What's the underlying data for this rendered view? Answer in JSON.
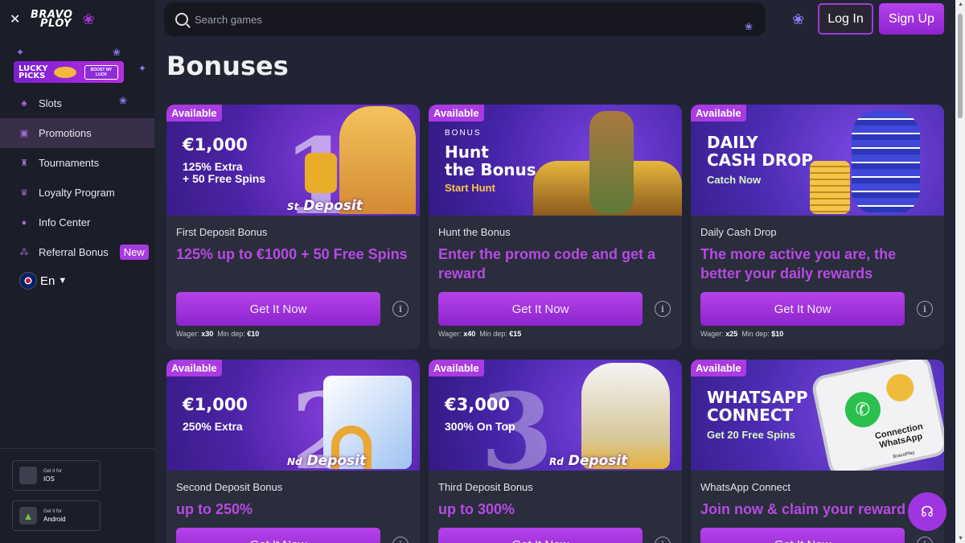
{
  "brand": {
    "name_line1": "BRAVO",
    "name_line2": "PLOY"
  },
  "promo_banner": {
    "title": "LUCKY PICKS",
    "button": "BOOST MY LUCK"
  },
  "header": {
    "search_placeholder": "Search games",
    "login_label": "Log In",
    "signup_label": "Sign Up"
  },
  "sidebar": {
    "items": [
      {
        "label": "Slots",
        "icon": "slots-icon"
      },
      {
        "label": "Promotions",
        "icon": "gift-icon",
        "active": true
      },
      {
        "label": "Tournaments",
        "icon": "trophy-icon"
      },
      {
        "label": "Loyalty Program",
        "icon": "crown-icon"
      },
      {
        "label": "Info Center",
        "icon": "info-icon"
      },
      {
        "label": "Referral Bonus",
        "icon": "users-icon",
        "badge": "New"
      }
    ],
    "language": "En",
    "stores": [
      {
        "small": "Get it for",
        "name": "IOS",
        "icon": "apple-icon"
      },
      {
        "small": "Get it for",
        "name": "Android",
        "icon": "android-icon"
      }
    ]
  },
  "page_title": "Bonuses",
  "cards": [
    {
      "badge": "Available",
      "banner": {
        "amount": "€1,000",
        "line1": "125% Extra",
        "line2": "+ 50 Free Spins",
        "big": "1",
        "ordinal": "St",
        "deposit": "Deposit"
      },
      "label": "First Deposit Bonus",
      "headline": "125% up to €1000 + 50 Free Spins",
      "button": "Get It Now",
      "wager_label": "Wager:",
      "wager": "x30",
      "min_label": "Min dep:",
      "min": "€10"
    },
    {
      "badge": "Available",
      "banner": {
        "small": "BONUS",
        "title1": "Hunt",
        "title2": "the Bonus",
        "cta": "Start Hunt"
      },
      "label": "Hunt the Bonus",
      "headline": "Enter the promo code and get a reward",
      "button": "Get It Now",
      "wager_label": "Wager:",
      "wager": "x40",
      "min_label": "Min dep:",
      "min": "€15"
    },
    {
      "badge": "Available",
      "banner": {
        "title1": "DAILY",
        "title2": "CASH DROP",
        "cta": "Catch Now"
      },
      "label": "Daily Cash Drop",
      "headline": "The more active you are, the better your daily rewards",
      "button": "Get It Now",
      "wager_label": "Wager:",
      "wager": "x25",
      "min_label": "Min dep:",
      "min": "$10"
    },
    {
      "badge": "Available",
      "banner": {
        "amount": "€1,000",
        "line1": "250% Extra",
        "big": "2",
        "ordinal": "Nd",
        "deposit": "Deposit"
      },
      "label": "Second Deposit Bonus",
      "headline": "up to 250%",
      "button": "Get It Now"
    },
    {
      "badge": "Available",
      "banner": {
        "amount": "€3,000",
        "line1": "300% On Top",
        "big": "3",
        "ordinal": "Rd",
        "deposit": "Deposit"
      },
      "label": "Third Deposit Bonus",
      "headline": "up to 300%",
      "button": "Get It Now"
    },
    {
      "badge": "Available",
      "banner": {
        "title1": "WHATSAPP",
        "title2": "CONNECT",
        "cta": "Get 20 Free Spins",
        "phone1": "Connection",
        "phone2": "WhatsApp",
        "phone3": "BravoPlay"
      },
      "label": "WhatsApp Connect",
      "headline": "Join now & claim your reward",
      "button": "Get It Now"
    }
  ],
  "colors": {
    "accent": "#a93be1",
    "background": "#212432",
    "sidebar": "#1b1d29",
    "card": "#2a2d3b"
  }
}
